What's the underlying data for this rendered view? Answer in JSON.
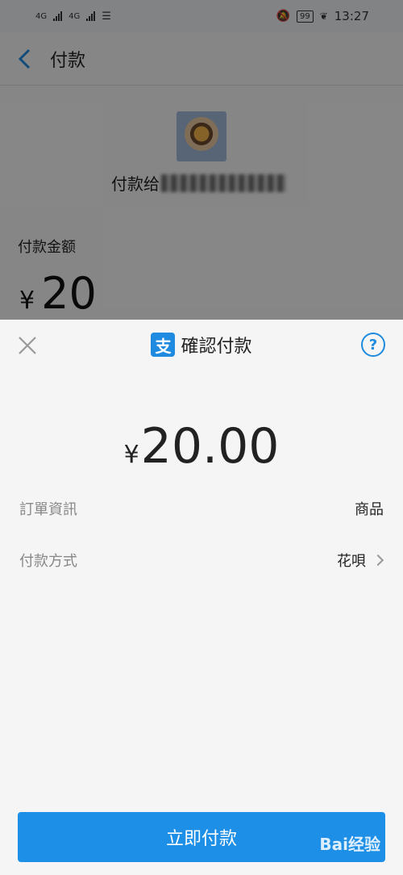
{
  "status_bar": {
    "signal_left": "4G",
    "signal_right": "4G",
    "battery": "99",
    "time": "13:27"
  },
  "background": {
    "nav_title": "付款",
    "payee_prefix": "付款给",
    "amount_label": "付款金额",
    "amount_currency": "¥",
    "amount_value": "20"
  },
  "sheet": {
    "title": "確認付款",
    "logo_glyph": "支",
    "help_glyph": "?",
    "currency": "¥",
    "amount": "20.00",
    "rows": [
      {
        "label": "訂單資訊",
        "value": "商品"
      },
      {
        "label": "付款方式",
        "value": "花唄"
      }
    ],
    "pay_button": "立即付款"
  },
  "watermark": "Bai经验"
}
